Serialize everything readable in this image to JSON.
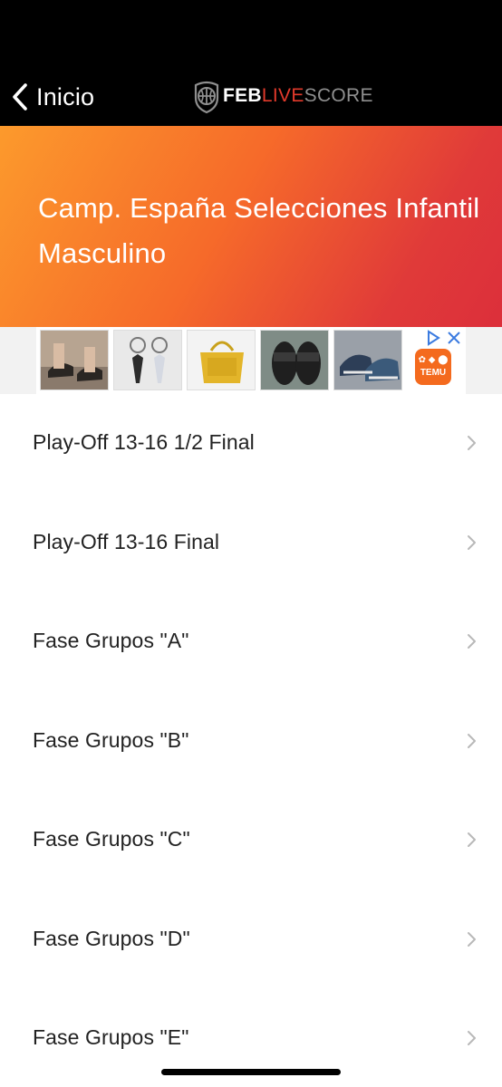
{
  "nav": {
    "back_label": "Inicio",
    "logo": {
      "part1": "FEB",
      "part2": "LIVE",
      "part3": "SCORE"
    }
  },
  "header": {
    "title": "Camp. España Selecciones Infantil Masculino"
  },
  "ad": {
    "brand": "TEMU",
    "thumbnails": [
      "sandals",
      "pendants",
      "yellow-bag",
      "slippers",
      "sneakers"
    ]
  },
  "rounds": [
    {
      "label": "Play-Off 13-16 1/2 Final"
    },
    {
      "label": "Play-Off 13-16 Final"
    },
    {
      "label": "Fase Grupos \"A\""
    },
    {
      "label": "Fase Grupos \"B\""
    },
    {
      "label": "Fase Grupos \"C\""
    },
    {
      "label": "Fase Grupos \"D\""
    },
    {
      "label": "Fase Grupos \"E\""
    }
  ],
  "colors": {
    "topbar": "#000000",
    "hero_start": "#fc9a2c",
    "hero_end": "#dc2f3a",
    "logo_live": "#e23a2b",
    "ad_badge": "#f46a1e"
  }
}
